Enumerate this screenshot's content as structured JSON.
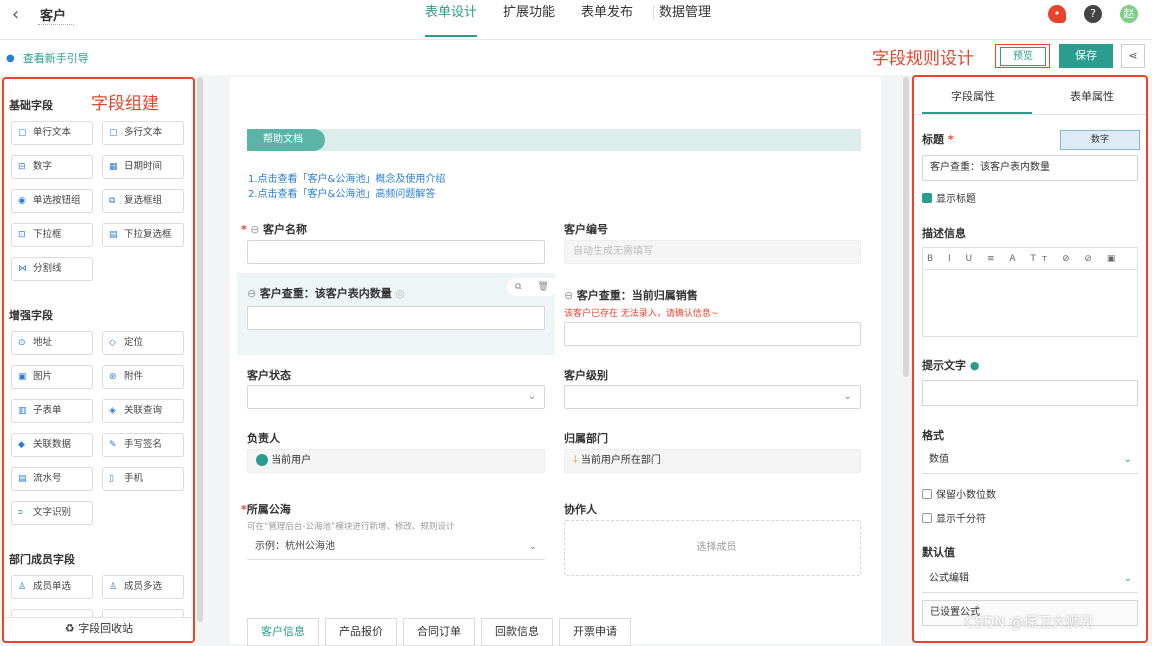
{
  "topbar": {
    "back_icon": "‹",
    "title": "客户",
    "tabs": [
      "表单设计",
      "扩展功能",
      "表单发布",
      "数据管理"
    ],
    "avatar_text": "赵"
  },
  "secondbar": {
    "guide_text": "查看新手引导",
    "rule_design_label": "字段规则设计",
    "preview_label": "预览",
    "save_label": "保存"
  },
  "left": {
    "red_label": "字段组建",
    "groups": [
      {
        "title": "基础字段",
        "items": [
          "单行文本",
          "多行文本",
          "数字",
          "日期时间",
          "单选按钮组",
          "复选框组",
          "下拉框",
          "下拉复选框",
          "分割线"
        ]
      },
      {
        "title": "增强字段",
        "items": [
          "地址",
          "定位",
          "图片",
          "附件",
          "子表单",
          "关联查询",
          "关联数据",
          "手写签名",
          "流水号",
          "手机",
          "文字识别"
        ]
      },
      {
        "title": "部门成员字段",
        "items": [
          "成员单选",
          "成员多选"
        ]
      }
    ],
    "recycle_label": "字段回收站"
  },
  "center": {
    "help_tab": "帮助文档",
    "help_links": [
      "1.点击查看「客户&公海池」概念及使用介绍",
      "2.点击查看「客户&公海池」高频问题解答"
    ],
    "fields": {
      "customer_name": "客户名称",
      "customer_no": "客户编号",
      "customer_no_placeholder": "自动生成无需填写",
      "query_count": "客户查重：该客户表内数量",
      "query_sales": "客户查重：当前归属销售",
      "warn_text": "该客户已存在 无法录入，请确认信息~",
      "status": "客户状态",
      "level": "客户级别",
      "owner": "负责人",
      "owner_value": "当前用户",
      "dept": "归属部门",
      "dept_value": "当前用户所在部门",
      "pool": "所属公海",
      "pool_hint": "可在“管理后台-公海池”模块进行新增、修改、规则设计",
      "pool_value": "示例：杭州公海池",
      "collaborator": "协作人",
      "collaborator_placeholder": "选择成员"
    },
    "bottom_tabs": [
      "客户信息",
      "产品报价",
      "合同订单",
      "回款信息",
      "开票申请"
    ]
  },
  "right": {
    "tabs": [
      "字段属性",
      "表单属性"
    ],
    "title_label": "标题",
    "number_badge": "数字",
    "title_value": "客户查重：该客户表内数量",
    "show_title": "显示标题",
    "desc_label": "描述信息",
    "editor_tools": "B I U ≡ A Tт ⊘ ⊘ ▣",
    "tip_label": "提示文字",
    "format_label": "格式",
    "format_value": "数值",
    "keep_decimal": "保留小数位数",
    "show_thousands": "显示千分符",
    "default_label": "默认值",
    "default_value": "公式编辑",
    "formula_value": "已设置公式"
  },
  "watermark": "CSDN @保卫大狮兄",
  "colors": {
    "accent": "#2a9d8f",
    "annotation": "#e8432b"
  }
}
